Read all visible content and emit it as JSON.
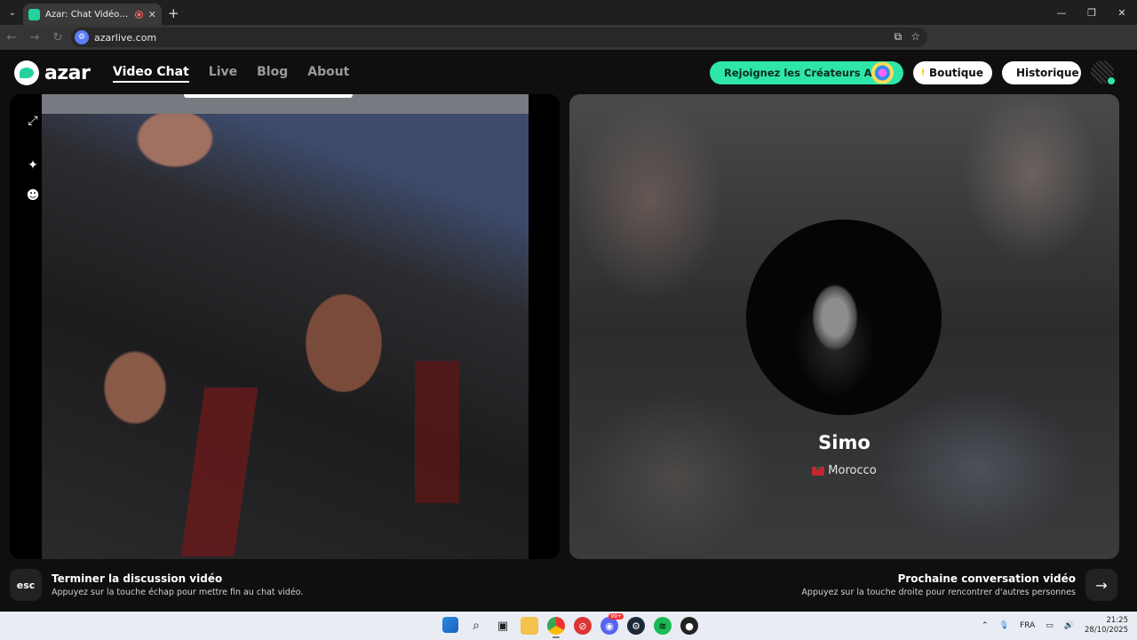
{
  "browser": {
    "tab_title": "Azar: Chat Vidéo, Rencontres",
    "new_tab": "+",
    "url": "azarlive.com",
    "menu_chevron": "⌄",
    "window_controls": [
      "—",
      "❐",
      "✕"
    ],
    "nav_icons": [
      "←",
      "→",
      "↻"
    ],
    "close_tab": "✕"
  },
  "site": {
    "logo_text": "azar",
    "nav": [
      {
        "label": "Video Chat",
        "active": true
      },
      {
        "label": "Live",
        "active": false
      },
      {
        "label": "Blog",
        "active": false
      },
      {
        "label": "About",
        "active": false
      }
    ],
    "creators_cta": "Rejoignez les Créateurs Azar",
    "boutique": "Boutique",
    "historique": "Historique",
    "accent_color": "#2ee6a8"
  },
  "left_tools": [
    "expand-icon",
    "sparkle-icon",
    "face-icon"
  ],
  "match": {
    "name": "Simo",
    "country": "Morocco"
  },
  "footer": {
    "esc_key": "esc",
    "end_title": "Terminer la discussion vidéo",
    "end_sub": "Appuyez sur la touche échap pour mettre fin au chat vidéo.",
    "next_title": "Prochaine conversation vidéo",
    "next_sub": "Appuyez sur la touche droite pour rencontrer d'autres personnes",
    "next_arrow": "→"
  },
  "taskbar": {
    "apps": [
      "start",
      "search",
      "task-view",
      "file-explorer",
      "chrome",
      "app-red",
      "discord",
      "steam",
      "spotify",
      "app-dark"
    ],
    "discord_badge": "99+",
    "language": "FRA",
    "time": "21:25",
    "date": "28/10/2025"
  }
}
